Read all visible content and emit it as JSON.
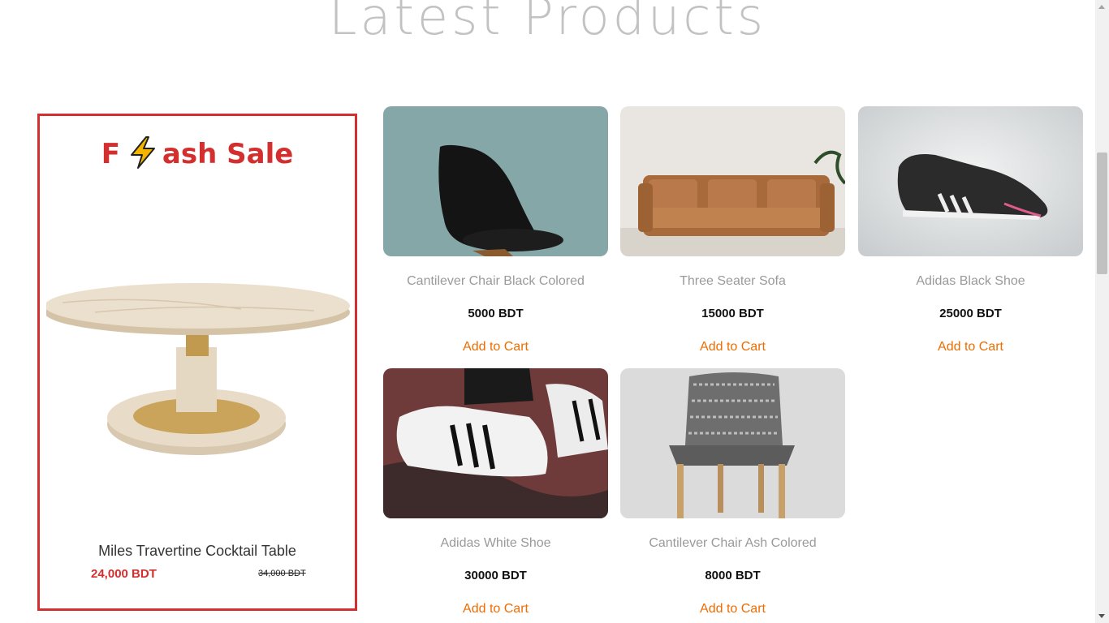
{
  "section": {
    "title": "Latest Products"
  },
  "flash_sale": {
    "title_prefix": "F",
    "title_suffix": "ash Sale",
    "icon": "lightning-bolt-icon",
    "product_name": "Miles Travertine Cocktail Table",
    "price": "24,000 BDT",
    "old_price": "34,000 BDT",
    "accent_color": "#d32f2f"
  },
  "products": [
    {
      "name": "Cantilever Chair Black Colored",
      "price": "5000 BDT",
      "cta": "Add to Cart"
    },
    {
      "name": "Three Seater Sofa",
      "price": "15000 BDT",
      "cta": "Add to Cart"
    },
    {
      "name": "Adidas Black Shoe",
      "price": "25000 BDT",
      "cta": "Add to Cart"
    },
    {
      "name": "Adidas White Shoe",
      "price": "30000 BDT",
      "cta": "Add to Cart"
    },
    {
      "name": "Cantilever Chair Ash Colored",
      "price": "8000 BDT",
      "cta": "Add to Cart"
    }
  ],
  "colors": {
    "cta": "#ef6c00",
    "title": "#c2c2c2"
  }
}
